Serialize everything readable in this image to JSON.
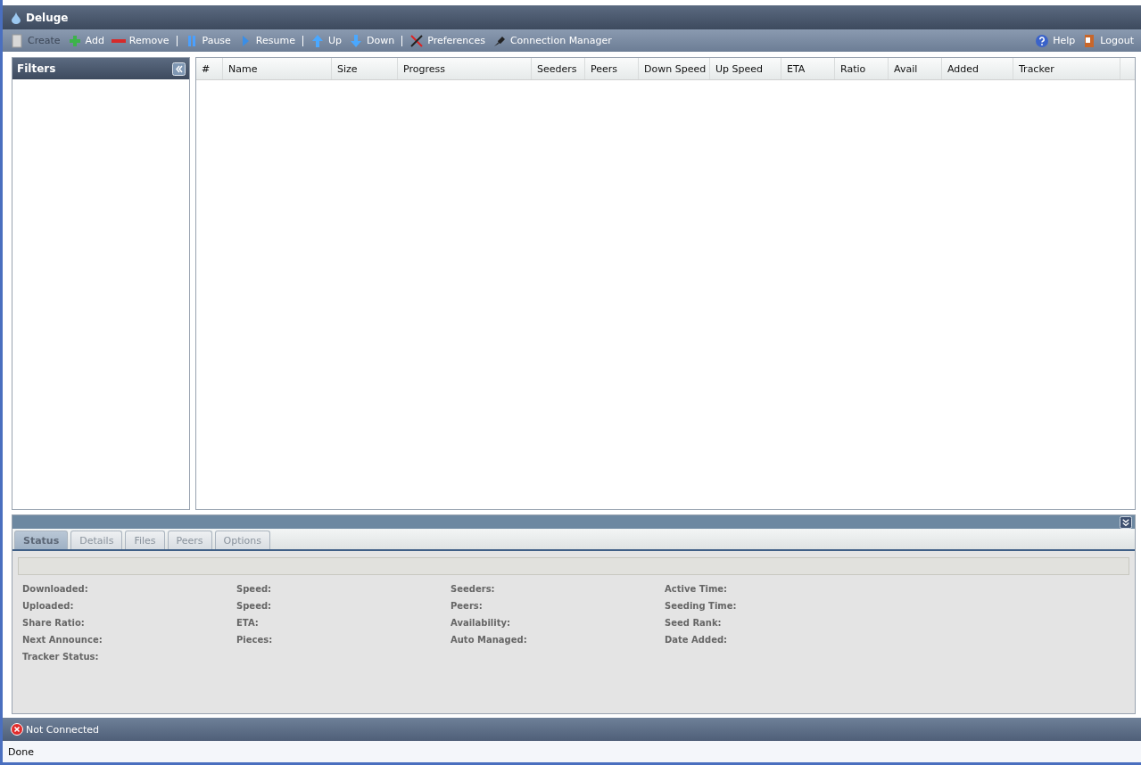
{
  "window": {
    "title": "Deluge"
  },
  "toolbar": {
    "items": [
      {
        "kind": "button",
        "label": "Create",
        "disabled": true
      },
      {
        "kind": "button",
        "label": "Add",
        "disabled": false
      },
      {
        "kind": "button",
        "label": "Remove",
        "disabled": false
      },
      {
        "kind": "separator"
      },
      {
        "kind": "button",
        "label": "Pause",
        "disabled": false
      },
      {
        "kind": "button",
        "label": "Resume",
        "disabled": false
      },
      {
        "kind": "separator"
      },
      {
        "kind": "button",
        "label": "Up",
        "disabled": false
      },
      {
        "kind": "button",
        "label": "Down",
        "disabled": false
      },
      {
        "kind": "separator"
      },
      {
        "kind": "button",
        "label": "Preferences",
        "disabled": false
      },
      {
        "kind": "button",
        "label": "Connection Manager",
        "disabled": false
      }
    ],
    "right_items": [
      {
        "label": "Help"
      },
      {
        "label": "Logout"
      }
    ]
  },
  "sidebar": {
    "title": "Filters"
  },
  "table": {
    "columns": [
      "#",
      "Name",
      "Size",
      "Progress",
      "Seeders",
      "Peers",
      "Down Speed",
      "Up Speed",
      "ETA",
      "Ratio",
      "Avail",
      "Added",
      "Tracker"
    ]
  },
  "details": {
    "tabs": [
      {
        "label": "Status",
        "selected": true
      },
      {
        "label": "Details",
        "selected": false
      },
      {
        "label": "Files",
        "selected": false
      },
      {
        "label": "Peers",
        "selected": false
      },
      {
        "label": "Options",
        "selected": false
      }
    ],
    "progress": {
      "level": 0
    },
    "field_columns": [
      [
        "Downloaded:",
        "Uploaded:",
        "Share Ratio:",
        "Next Announce:",
        "Tracker Status:"
      ],
      [
        "Speed:",
        "Speed:",
        "ETA:",
        "Pieces:"
      ],
      [
        "Seeders:",
        "Peers:",
        "Availability:",
        "Auto Managed:"
      ],
      [
        "Active Time:",
        "Seeding Time:",
        "Seed Rank:",
        "Date Added:"
      ]
    ]
  },
  "status_bar": {
    "connection": "Not Connected"
  },
  "browser_status": "Done"
}
